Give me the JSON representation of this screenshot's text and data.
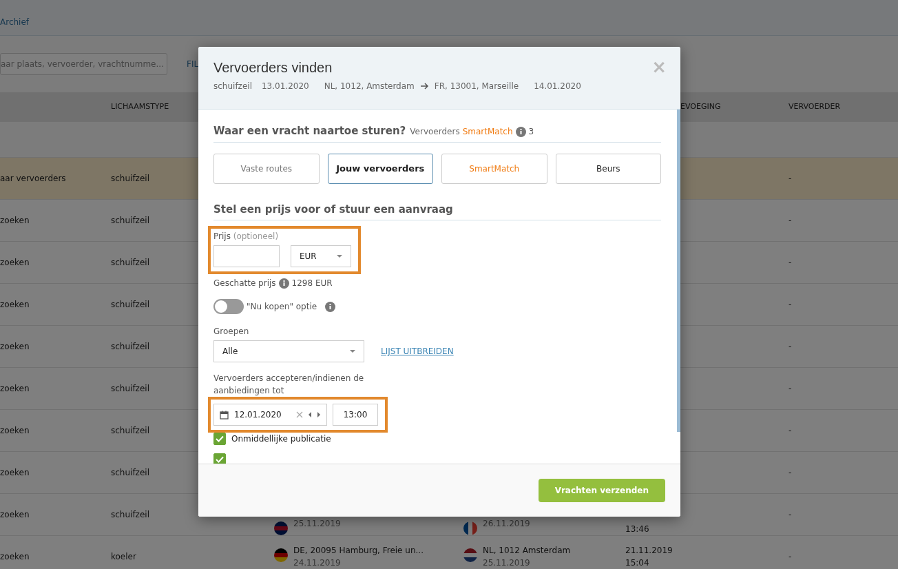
{
  "page": {
    "tab_label": "Archief",
    "search": {
      "placeholder": "aar plaats, vervoerder, vrachtnumme..."
    },
    "filter_link": "FIL"
  },
  "table": {
    "headers": {
      "column_2": "LICHAAMSTYPE",
      "column_5": "EVOEGING",
      "column_6": "VERVOERDER"
    },
    "rows": [
      {
        "highlighted": true,
        "column_1": "aar vervoerders",
        "column_2": "schuifzeil",
        "column_6": "-"
      },
      {
        "highlighted": false,
        "column_1": "zoeken",
        "column_2": "schuifzeil",
        "column_6": "-"
      },
      {
        "highlighted": false,
        "column_1": "zoeken",
        "column_2": "schuifzeil",
        "column_6": "-"
      },
      {
        "highlighted": false,
        "column_1": "zoeken",
        "column_2": "schuifzeil",
        "column_6": "-"
      },
      {
        "highlighted": false,
        "column_1": "zoeken",
        "column_2": "schuifzeil",
        "column_6": "-"
      },
      {
        "highlighted": false,
        "column_1": "zoeken",
        "column_2": "schuifzeil",
        "column_6": "-"
      },
      {
        "highlighted": false,
        "column_1": "zoeken",
        "column_2": "schuifzeil",
        "column_6": "-"
      },
      {
        "highlighted": false,
        "column_1": "zoeken",
        "column_2": "schuifzeil",
        "column_6": "-"
      },
      {
        "highlighted": false,
        "column_1": "zoeken",
        "column_2": "schuifzeil",
        "column_3": {
          "kind": "gb",
          "lines": [
            "25.11.2019"
          ]
        },
        "column_4": {
          "kind": "fr",
          "lines": [
            "26.11.2019"
          ]
        },
        "column_5": [
          "13:46"
        ],
        "column_6": "-"
      },
      {
        "highlighted": false,
        "column_1": "zoeken",
        "column_2": "koeler",
        "column_3": {
          "kind": "de",
          "lines": [
            "DE, 20095 Hamburg, Freie un...",
            "24.11.2019"
          ]
        },
        "column_4": {
          "kind": "nl",
          "lines": [
            "NL, 1012 Amsterdam",
            "25.11.2019"
          ]
        },
        "column_5": [
          "21.11.2019",
          "15:04"
        ],
        "column_6": "-"
      }
    ]
  },
  "modal": {
    "title": "Vervoerders vinden",
    "close": "×",
    "summary": {
      "body_type": "schuifzeil",
      "load_date": "13.01.2020",
      "from": "NL, 1012, Amsterdam",
      "to": "FR, 13001, Marseille",
      "unload_date": "14.01.2020"
    },
    "send_section": {
      "heading": "Waar een vracht naartoe sturen?",
      "carriers_label": "Vervoerders",
      "carriers_brand": "SmartMatch",
      "carriers_count": "3"
    },
    "tabs": [
      {
        "label": "Vaste routes",
        "kind": "muted",
        "selected": false
      },
      {
        "label": "Jouw vervoerders",
        "kind": "normal",
        "selected": true
      },
      {
        "label": "SmartMatch",
        "kind": "brand",
        "selected": false
      },
      {
        "label": "Beurs",
        "kind": "normal",
        "selected": false
      }
    ],
    "price_section": {
      "heading": "Stel een prijs voor of stuur een aanvraag"
    },
    "price": {
      "label": "Prijs",
      "optional": "(optioneel)",
      "currency": "EUR",
      "annotated": true
    },
    "estimate": {
      "label": "Geschatte prijs",
      "value": "1298 EUR"
    },
    "buy_now": {
      "label": "\"Nu kopen\" optie",
      "on": false
    },
    "groups": {
      "label": "Groepen",
      "value": "Alle",
      "link": "LIJST UITBREIDEN"
    },
    "deadline": {
      "label": "Vervoerders accepteren/indienen de aanbiedingen tot",
      "date": "12.01.2020",
      "time": "13:00",
      "annotated": true
    },
    "checkboxes": [
      {
        "label": "Onmiddellijke publicatie",
        "checked": true
      },
      {
        "checked": true
      }
    ],
    "submit": "Vrachten verzenden"
  }
}
